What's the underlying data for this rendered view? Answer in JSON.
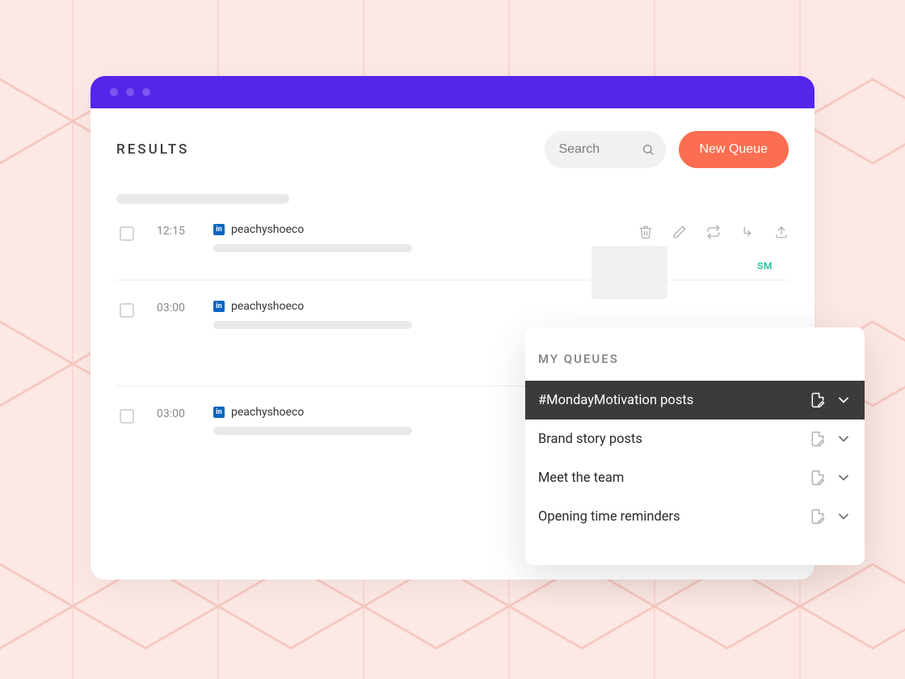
{
  "header": {
    "title": "RESULTS",
    "search_placeholder": "Search",
    "new_button_label": "New Queue"
  },
  "posts": [
    {
      "time": "12:15",
      "platform": "linkedin",
      "platform_glyph": "in",
      "account": "peachyshoeco",
      "show_actions": true,
      "show_thumb": true,
      "badge": "SM"
    },
    {
      "time": "03:00",
      "platform": "linkedin",
      "platform_glyph": "in",
      "account": "peachyshoeco",
      "show_actions": false,
      "show_thumb": false,
      "badge": ""
    },
    {
      "time": "03:00",
      "platform": "linkedin",
      "platform_glyph": "in",
      "account": "peachyshoeco",
      "show_actions": false,
      "show_thumb": false,
      "badge": ""
    }
  ],
  "queues": {
    "heading": "MY QUEUES",
    "items": [
      {
        "label": "#MondayMotivation posts",
        "active": true
      },
      {
        "label": "Brand story posts",
        "active": false
      },
      {
        "label": "Meet the team",
        "active": false
      },
      {
        "label": "Opening time reminders",
        "active": false
      }
    ]
  }
}
